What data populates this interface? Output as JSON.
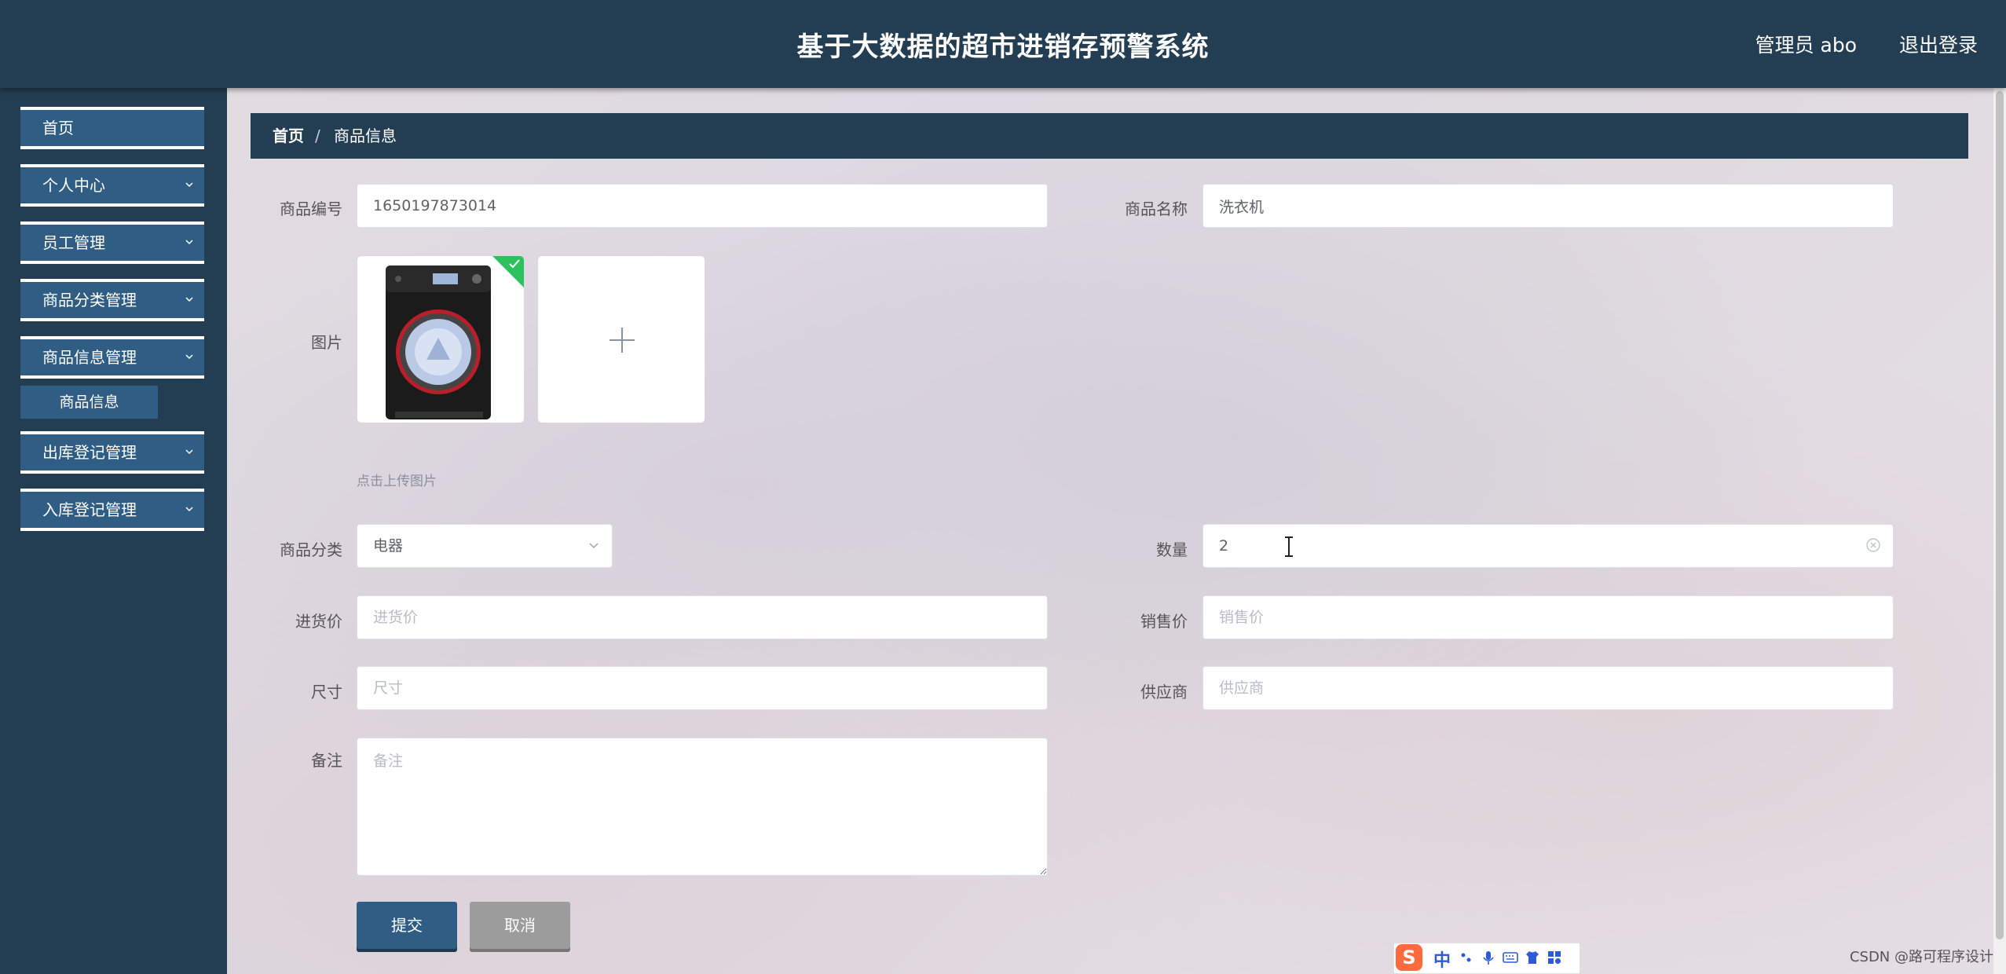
{
  "header": {
    "title": "基于大数据的超市进销存预警系统",
    "user": "管理员 abo",
    "logout": "退出登录"
  },
  "sidebar": {
    "items": [
      {
        "label": "首页",
        "has_chevron": false
      },
      {
        "label": "个人中心",
        "has_chevron": true
      },
      {
        "label": "员工管理",
        "has_chevron": true
      },
      {
        "label": "商品分类管理",
        "has_chevron": true
      },
      {
        "label": "商品信息管理",
        "has_chevron": true
      },
      {
        "label": "出库登记管理",
        "has_chevron": true
      },
      {
        "label": "入库登记管理",
        "has_chevron": true
      }
    ],
    "submenu": {
      "label": "商品信息"
    }
  },
  "breadcrumb": {
    "home": "首页",
    "separator": "/",
    "current": "商品信息"
  },
  "form": {
    "code": {
      "label": "商品编号",
      "value": "1650197873014"
    },
    "name": {
      "label": "商品名称",
      "value": "洗衣机"
    },
    "image": {
      "label": "图片",
      "tip": "点击上传图片"
    },
    "category": {
      "label": "商品分类",
      "value": "电器"
    },
    "quantity": {
      "label": "数量",
      "value": "2"
    },
    "purchase_price": {
      "label": "进货价",
      "placeholder": "进货价"
    },
    "sale_price": {
      "label": "销售价",
      "placeholder": "销售价"
    },
    "size": {
      "label": "尺寸",
      "placeholder": "尺寸"
    },
    "supplier": {
      "label": "供应商",
      "placeholder": "供应商"
    },
    "note": {
      "label": "备注",
      "placeholder": "备注"
    },
    "submit": "提交",
    "cancel": "取消"
  },
  "ime": {
    "logo": "S",
    "mode": "中"
  },
  "watermark": "CSDN @路可程序设计",
  "colors": {
    "header_bg": "#233d52",
    "menu_bg": "#2f5d84",
    "breadcrumb_bg": "#233d52",
    "success_badge": "#2bc25e",
    "cancel_bg": "#9c9c9c"
  },
  "icons": {
    "chevron": "chevron-down-icon",
    "upload": "plus-icon",
    "select": "chevron-down-icon",
    "clear": "circle-close-icon",
    "check": "check-icon"
  }
}
